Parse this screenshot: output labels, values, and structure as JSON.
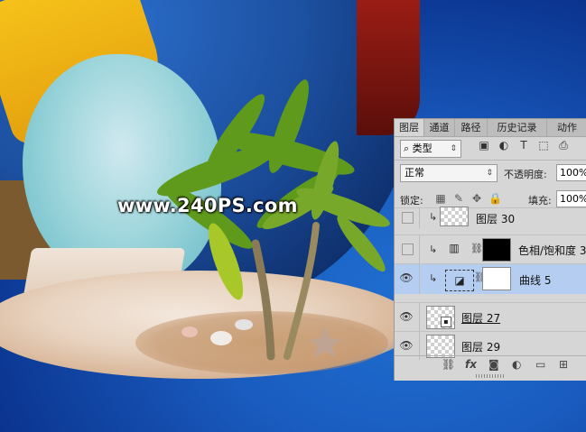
{
  "watermark": "www.240PS.com",
  "tabs": [
    "图层",
    "通道",
    "路径",
    "历史记录",
    "动作"
  ],
  "filter": {
    "label": "类型",
    "icons": [
      "image-filter-icon",
      "adjustment-filter-icon",
      "type-filter-icon",
      "shape-filter-icon",
      "smartobject-filter-icon"
    ]
  },
  "blend_mode": "正常",
  "opacity": {
    "label": "不透明度:",
    "value": "100%"
  },
  "lock": {
    "label": "锁定:"
  },
  "fill": {
    "label": "填充:",
    "value": "100%"
  },
  "layers": [
    {
      "name": "图层 30",
      "visible": false,
      "clipped": true,
      "type": "pixel"
    },
    {
      "name": "色相/饱和度 3",
      "visible": false,
      "clipped": true,
      "type": "hue-saturation"
    },
    {
      "name": "曲线 5",
      "visible": true,
      "clipped": true,
      "type": "curves",
      "selected": true
    },
    {
      "name": "图层 27",
      "visible": true,
      "clipped": false,
      "type": "smart-object"
    },
    {
      "name": "图层 29",
      "visible": true,
      "clipped": false,
      "type": "pixel"
    }
  ],
  "footer_icons": [
    "link-icon",
    "fx-icon",
    "mask-icon",
    "adjustment-icon",
    "folder-icon",
    "new-layer-icon"
  ],
  "colors": {
    "panel_bg": "#d6d6d6",
    "selected_row": "#b6cdf2"
  }
}
